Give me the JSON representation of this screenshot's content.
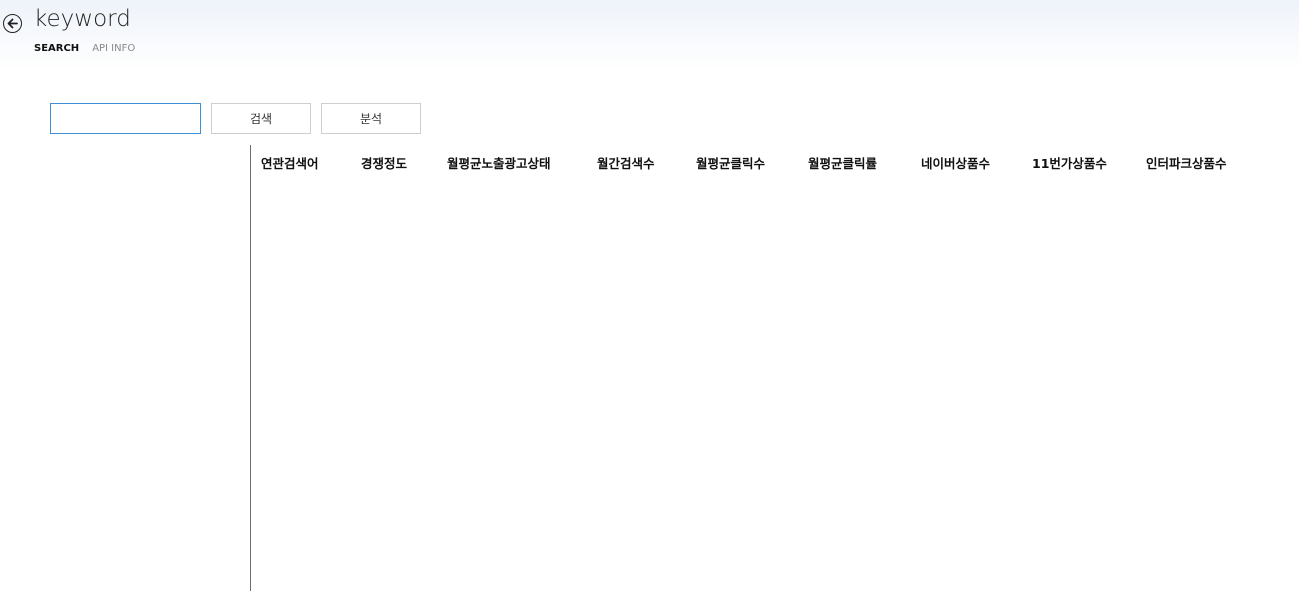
{
  "header": {
    "title": "keyword"
  },
  "nav": {
    "tabs": [
      {
        "label": "SEARCH",
        "active": true
      },
      {
        "label": "API INFO",
        "active": false
      }
    ]
  },
  "toolbar": {
    "input_value": "",
    "search_label": "검색",
    "analyze_label": "분석"
  },
  "table": {
    "columns": [
      "연관검색어",
      "경쟁정도",
      "월평균노출광고상태",
      "월간검색수",
      "월평균클릭수",
      "월평균클릭률",
      "네이버상품수",
      "11번가상품수",
      "인터파크상품수"
    ],
    "rows": []
  },
  "colors": {
    "input_border": "#3d8fd6",
    "button_border": "#cfcfcf",
    "divider": "#6e6e6e"
  }
}
